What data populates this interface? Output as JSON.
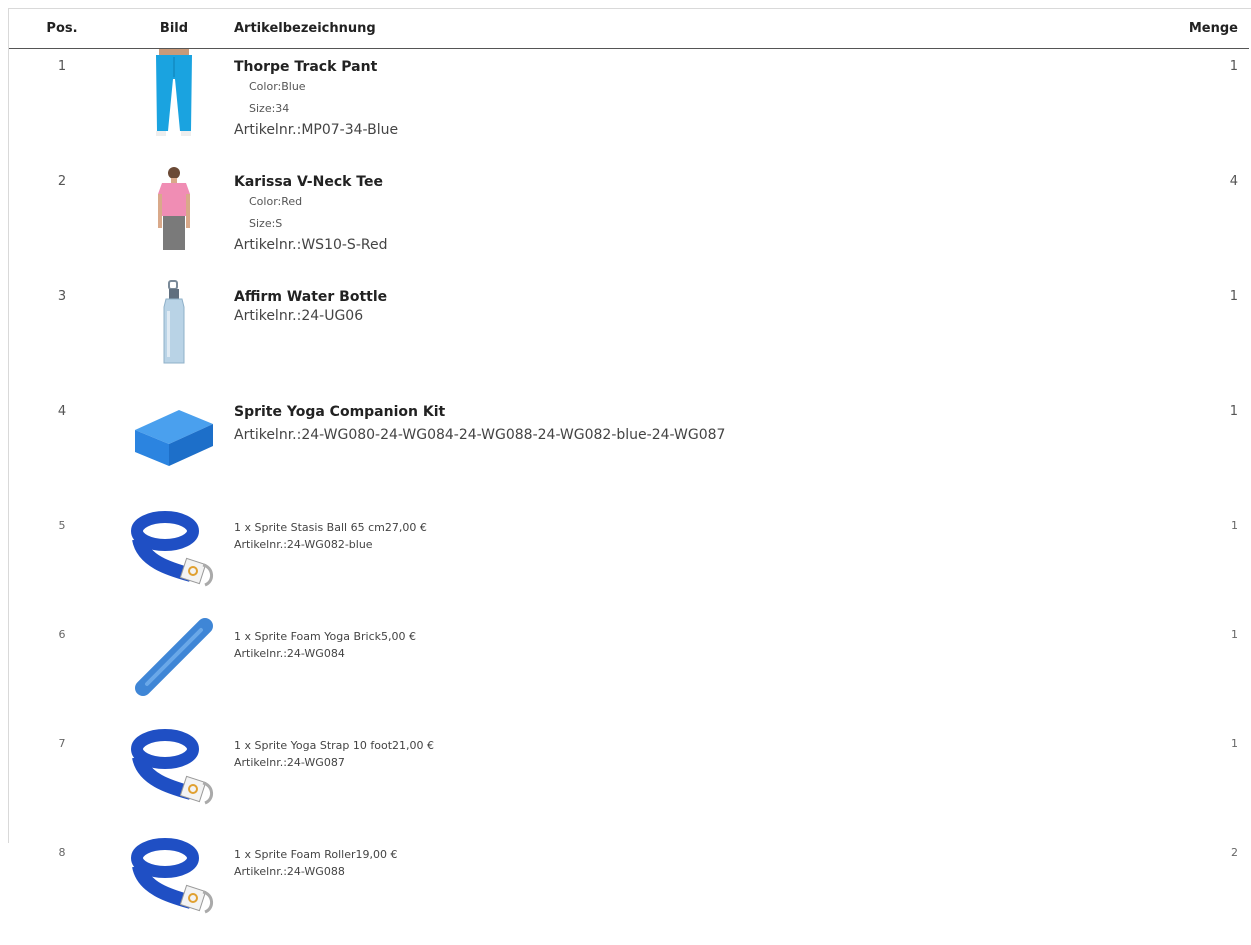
{
  "headers": {
    "pos": "Pos.",
    "image": "Bild",
    "description": "Artikelbezeichnung",
    "quantity": "Menge"
  },
  "rows": [
    {
      "pos": "1",
      "name": "Thorpe Track Pant",
      "option1": "Color:Blue",
      "option2": "Size:34",
      "sku": "Artikelnr.:MP07-34-Blue",
      "qty": "1",
      "icon": "track-pant-icon"
    },
    {
      "pos": "2",
      "name": "Karissa V-Neck Tee",
      "option1": "Color:Red",
      "option2": "Size:S",
      "sku": "Artikelnr.:WS10-S-Red",
      "qty": "4",
      "icon": "tee-icon"
    },
    {
      "pos": "3",
      "name": "Affirm Water Bottle",
      "sku": "Artikelnr.:24-UG06",
      "qty": "1",
      "icon": "water-bottle-icon"
    },
    {
      "pos": "4",
      "name": "Sprite Yoga Companion Kit",
      "sku": "Artikelnr.:24-WG080-24-WG084-24-WG088-24-WG082-blue-24-WG087",
      "qty": "1",
      "icon": "yoga-brick-icon"
    }
  ],
  "subrows": [
    {
      "pos": "5",
      "line": "1 x Sprite Stasis Ball 65 cm",
      "price": "27,00 €",
      "sku": "Artikelnr.:24-WG082-blue",
      "qty": "1",
      "icon": "yoga-strap-icon"
    },
    {
      "pos": "6",
      "line": "1 x Sprite Foam Yoga Brick",
      "price": "5,00 €",
      "sku": "Artikelnr.:24-WG084",
      "qty": "1",
      "icon": "foam-roller-icon"
    },
    {
      "pos": "7",
      "line": "1 x Sprite Yoga Strap 10 foot",
      "price": "21,00 €",
      "sku": "Artikelnr.:24-WG087",
      "qty": "1",
      "icon": "yoga-strap-icon"
    },
    {
      "pos": "8",
      "line": "1 x Sprite Foam Roller",
      "price": "19,00 €",
      "sku": "Artikelnr.:24-WG088",
      "qty": "2",
      "icon": "yoga-strap-icon"
    }
  ],
  "colors": {
    "pant": "#1aa3e0",
    "tee": "#f08db4",
    "bottle": "#b9d3e6",
    "brick": "#2b84e0",
    "strap": "#1f4fc4",
    "roller": "#3f86d6"
  }
}
